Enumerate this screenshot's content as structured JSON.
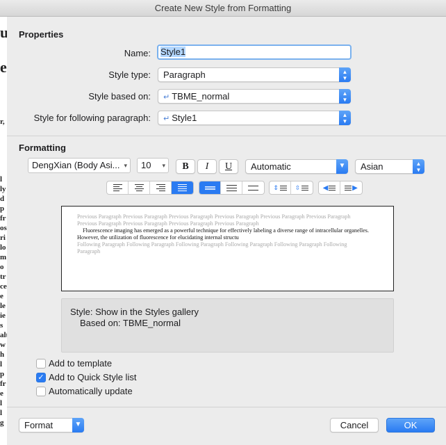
{
  "window": {
    "title": "Create New Style from Formatting"
  },
  "background_doc": {
    "glyphs": [
      "u",
      "e",
      "r,",
      "l",
      "ly",
      "d",
      "p",
      "fr",
      "os",
      "ri",
      "lo",
      "m",
      "o",
      "tr",
      "ce",
      "e",
      "le",
      "ie",
      "s",
      "alt",
      "w",
      "h",
      "l",
      "p",
      "fr",
      "e",
      "l",
      "l",
      "g"
    ]
  },
  "properties": {
    "heading": "Properties",
    "name_label": "Name:",
    "name_value": "Style1",
    "style_type_label": "Style type:",
    "style_type_value": "Paragraph",
    "based_on_label": "Style based on:",
    "based_on_value": "TBME_normal",
    "following_label": "Style for following paragraph:",
    "following_value": "Style1",
    "return_glyph": "↵"
  },
  "formatting": {
    "heading": "Formatting",
    "font_name": "DengXian (Body Asi...",
    "font_size": "10",
    "bold": "B",
    "italic": "I",
    "underline": "U",
    "color_value": "Automatic",
    "script_value": "Asian"
  },
  "preview": {
    "previous_paragraph": "Previous Paragraph Previous Paragraph Previous Paragraph Previous Paragraph Previous Paragraph Previous Paragraph Previous Paragraph Previous Paragraph Previous Paragraph Previous Paragraph",
    "sample_text": "Fluorescence imaging has emerged as a powerful technique for effectively labeling a diverse range of intracellular organelles. However, the utilization of fluorescence for elucidating internal structu",
    "following_paragraph": "Following Paragraph Following Paragraph Following Paragraph Following Paragraph Following Paragraph Following Paragraph"
  },
  "description": {
    "line1": "Style: Show in the Styles gallery",
    "line2": "Based on: TBME_normal"
  },
  "options": {
    "add_to_template": {
      "label": "Add to template",
      "checked": false
    },
    "add_to_quick_style": {
      "label": "Add to Quick Style list",
      "checked": true
    },
    "auto_update": {
      "label": "Automatically update",
      "checked": false
    }
  },
  "footer": {
    "format_label": "Format",
    "cancel_label": "Cancel",
    "ok_label": "OK"
  },
  "colors": {
    "accent": "#2a7bf2",
    "focus_ring": "#7ab1ee",
    "selection": "#b3d7ff"
  },
  "icons": {
    "checkmark": "✓",
    "popup_arrows": "⌃⌄",
    "caret": "▾"
  }
}
